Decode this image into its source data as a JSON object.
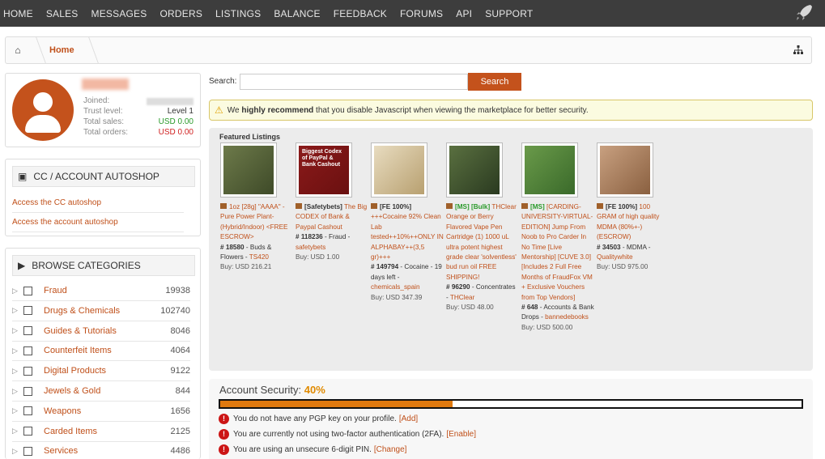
{
  "nav": {
    "items": [
      "HOME",
      "SALES",
      "MESSAGES",
      "ORDERS",
      "LISTINGS",
      "BALANCE",
      "FEEDBACK",
      "FORUMS",
      "API",
      "SUPPORT"
    ]
  },
  "breadcrumb": {
    "home": "Home"
  },
  "profile": {
    "rows": [
      {
        "label": "Joined:",
        "value": ""
      },
      {
        "label": "Trust level:",
        "value": "Level 1"
      },
      {
        "label": "Total sales:",
        "value": "USD 0.00"
      },
      {
        "label": "Total orders:",
        "value": "USD 0.00"
      }
    ]
  },
  "autoshop": {
    "title": "CC / ACCOUNT AUTOSHOP",
    "links": [
      "Access the CC autoshop",
      "Access the account autoshop"
    ]
  },
  "categories": {
    "title": "BROWSE CATEGORIES",
    "items": [
      {
        "name": "Fraud",
        "count": "19938"
      },
      {
        "name": "Drugs & Chemicals",
        "count": "102740"
      },
      {
        "name": "Guides & Tutorials",
        "count": "8046"
      },
      {
        "name": "Counterfeit Items",
        "count": "4064"
      },
      {
        "name": "Digital Products",
        "count": "9122"
      },
      {
        "name": "Jewels & Gold",
        "count": "844"
      },
      {
        "name": "Weapons",
        "count": "1656"
      },
      {
        "name": "Carded Items",
        "count": "2125"
      },
      {
        "name": "Services",
        "count": "4486"
      }
    ]
  },
  "search": {
    "label": "Search:",
    "value": "",
    "button": "Search"
  },
  "alert": {
    "pre": "We ",
    "bold": "highly recommend",
    "post": " that you disable Javascript when viewing the marketplace for better security."
  },
  "featured": {
    "title": "Featured Listings",
    "listings": [
      {
        "tag": "",
        "title": "1oz [28g] \"AAAA\" -Pure Power Plant- (Hybrid/Indoor) <FREE ESCROW>",
        "id": "# 18580",
        "category": " - Buds & Flowers - ",
        "vendor": "TS420",
        "price": "Buy: USD 216.21",
        "colors": [
          "#6d7a4a",
          "#3e4a28"
        ]
      },
      {
        "tag": "[Safetybets]",
        "title": " The Big CODEX of Bank & Paypal Cashout",
        "id": "# 118236",
        "category": " - Fraud - ",
        "vendor": "safetybets",
        "price": "Buy: USD 1.00",
        "image_text": "Biggest Codex of PayPal & Bank Cashout",
        "colors": [
          "#8b1a1a",
          "#6a1010"
        ]
      },
      {
        "tag": "[FE 100%]",
        "title": " +++Cocaine 92% Clean Lab tested++10%++ONLY IN ALPHABAY++(3,5 gr)+++",
        "id": "# 149794",
        "category": " - Cocaine - 19 days left - ",
        "vendor": "chemicals_spain",
        "price": "Buy: USD 347.39",
        "colors": [
          "#e8dcc0",
          "#b8a070"
        ]
      },
      {
        "tag": "[MS] [Bulk]",
        "title": " THClear Orange or Berry Flavored Vape Pen Cartridge (1) 1000 uL ultra potent highest grade clear 'solventless' bud run oil FREE SHIPPING!",
        "id": "# 96290",
        "category": " - Concentrates - ",
        "vendor": "THClear",
        "price": "Buy: USD 48.00",
        "colors": [
          "#5a7040",
          "#2a3a20"
        ]
      },
      {
        "tag": "[MS]",
        "title": " [CARDING-UNIVERSITY-VIRTUAL-EDITION] Jump From Noob to Pro Carder In No Time [Live Mentorship] [CUVE 3.0] [Includes 2 Full Free Months of FraudFox VM + Exclusive Vouchers from Top Vendors]",
        "id": "# 648",
        "category": " - Accounts & Bank Drops - ",
        "vendor": "bannedebooks",
        "price": "Buy: USD 500.00",
        "colors": [
          "#6a9a4a",
          "#3a6a2a"
        ]
      },
      {
        "tag": "[FE 100%]",
        "title": " 100 GRAM of high quality MDMA (80%+-) (ESCROW)",
        "id": "# 34503",
        "category": " - MDMA - ",
        "vendor": "Qualitywhite",
        "price": "Buy: USD 975.00",
        "colors": [
          "#c8a080",
          "#8a6040"
        ]
      }
    ]
  },
  "security": {
    "label": "Account Security:",
    "percent": "40%",
    "progress": 0.4,
    "issues": [
      {
        "text": "You do not have any PGP key on your profile.",
        "action": "[Add]"
      },
      {
        "text": "You are currently not using two-factor authentication (2FA).",
        "action": "[Enable]"
      },
      {
        "text": "You are using an unsecure 6-digit PIN.",
        "action": "[Change]"
      }
    ]
  }
}
